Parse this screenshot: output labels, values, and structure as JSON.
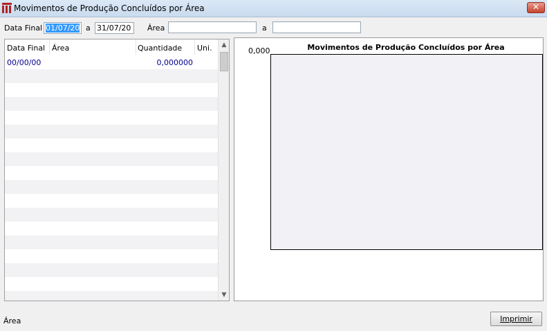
{
  "window": {
    "title": "Movimentos de Produção Concluídos por Área",
    "close_glyph": "✕"
  },
  "filters": {
    "date_label": "Data Final",
    "date_from": "01/07/20",
    "date_sep": "a",
    "date_to": "31/07/20",
    "area_label": "Área",
    "area_from": "",
    "area_sep": "a",
    "area_to": ""
  },
  "table": {
    "columns": [
      "Data Final",
      "Área",
      "Quantidade",
      "Uni."
    ],
    "rows": [
      {
        "data_final": "00/00/00",
        "area": "",
        "quantidade": "0,000000",
        "uni": ""
      }
    ],
    "scroll_up": "▲",
    "scroll_down": "▼"
  },
  "chart_data": {
    "type": "bar",
    "title": "Movimentos de Produção Concluídos por Área",
    "categories": [],
    "values": [],
    "y_tick_labels": [
      "0,000"
    ],
    "grid": false
  },
  "status": {
    "label": "Área"
  },
  "buttons": {
    "print": "Imprimir"
  },
  "colors": {
    "row_text": "#00008b",
    "selection": "#3399ff",
    "close": "#c7442f"
  },
  "icons": {
    "app": "red-columns-app-icon",
    "close": "close-icon"
  }
}
